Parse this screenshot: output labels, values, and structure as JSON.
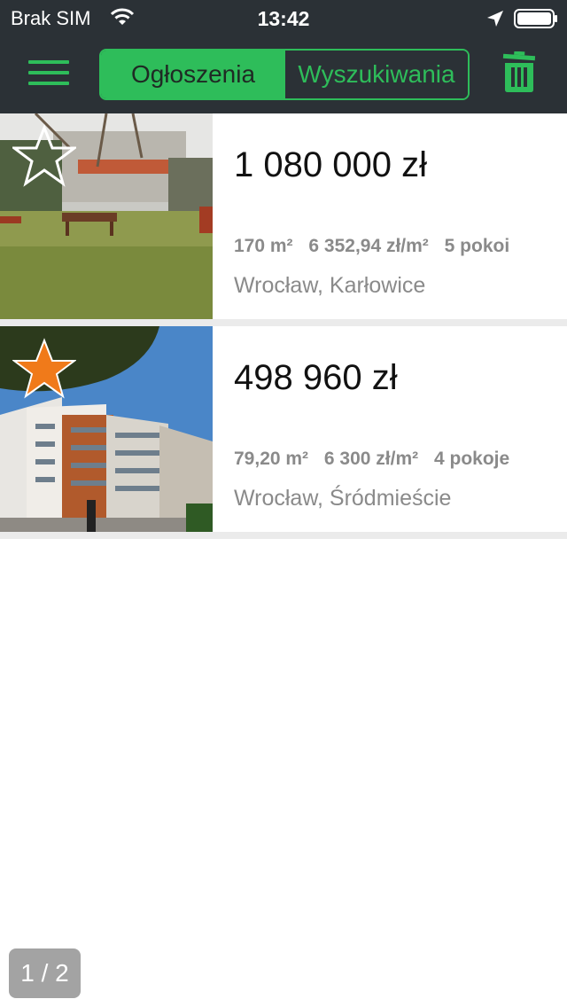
{
  "status": {
    "carrier": "Brak SIM",
    "time": "13:42"
  },
  "header": {
    "tabs": [
      {
        "label": "Ogłoszenia",
        "active": true
      },
      {
        "label": "Wyszukiwania",
        "active": false
      }
    ],
    "accent_color": "#2ebd5a",
    "bar_color": "#2b3136"
  },
  "listings": [
    {
      "price": "1 080 000 zł",
      "area": "170 m²",
      "price_per_m2": "6 352,94 zł/m²",
      "rooms": "5 pokoi",
      "location": "Wrocław, Karłowice",
      "favorite": false
    },
    {
      "price": "498 960 zł",
      "area": "79,20 m²",
      "price_per_m2": "6 300 zł/m²",
      "rooms": "4 pokoje",
      "location": "Wrocław, Śródmieście",
      "favorite": true
    }
  ],
  "pager": {
    "label": "1 / 2"
  }
}
